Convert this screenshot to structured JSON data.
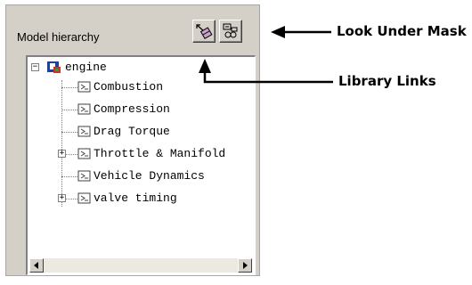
{
  "panel": {
    "title": "Model hierarchy",
    "toolbar": [
      {
        "name": "look-under-mask-icon"
      },
      {
        "name": "library-links-icon"
      }
    ]
  },
  "tree": {
    "root": {
      "label": "engine",
      "expander": "−",
      "icon": "model-icon"
    },
    "children": [
      {
        "label": "Combustion",
        "expander": "",
        "icon": "subsystem-icon"
      },
      {
        "label": "Compression",
        "expander": "",
        "icon": "subsystem-icon"
      },
      {
        "label": "Drag Torque",
        "expander": "",
        "icon": "subsystem-icon"
      },
      {
        "label": "Throttle & Manifold",
        "expander": "+",
        "icon": "subsystem-icon"
      },
      {
        "label": "Vehicle Dynamics",
        "expander": "",
        "icon": "subsystem-icon"
      },
      {
        "label": "valve timing",
        "expander": "+",
        "icon": "subsystem-icon"
      }
    ]
  },
  "callouts": {
    "look_under_mask": "Look Under Mask",
    "library_links": "Library Links"
  }
}
